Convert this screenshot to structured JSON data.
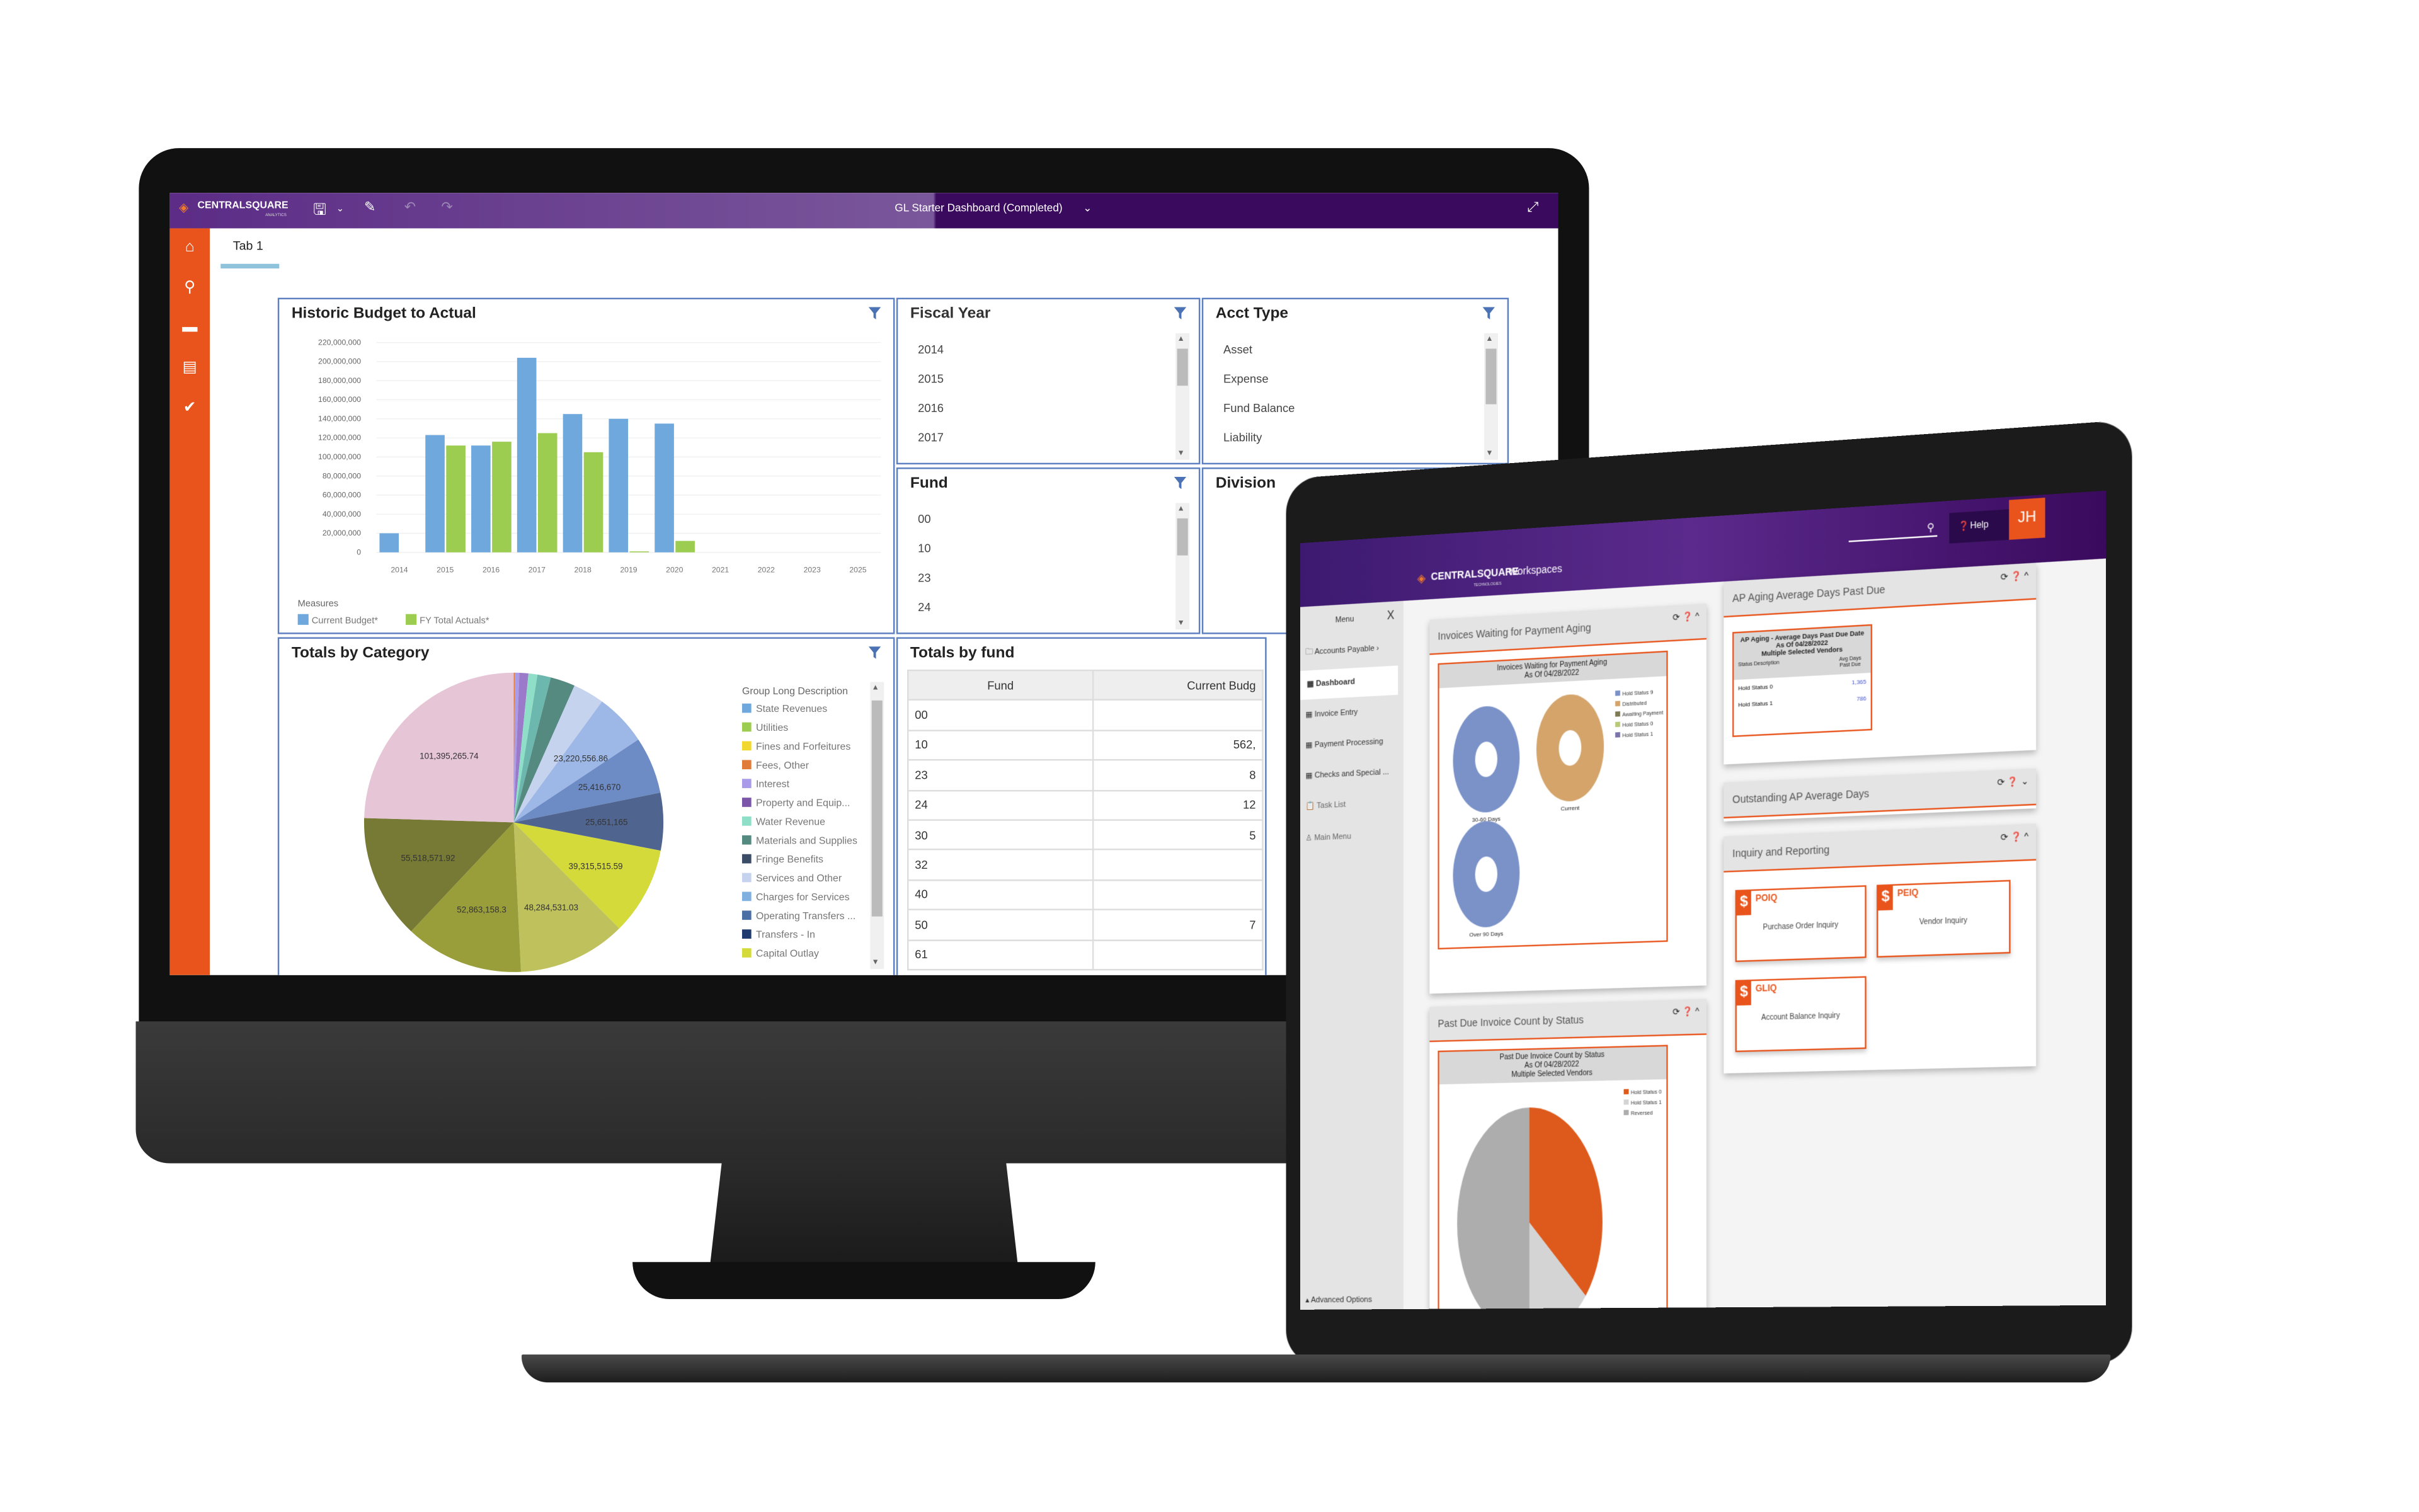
{
  "monitor": {
    "topbar": {
      "logo": "CENTRALSQUARE",
      "logo_sub": "ANALYTICS",
      "title": "GL Starter Dashboard (Completed)",
      "icons": [
        "save-icon",
        "chevron-down-icon",
        "pencil-icon",
        "undo-icon",
        "redo-icon",
        "expand-icon"
      ]
    },
    "sidebar_icons": [
      "home-icon",
      "search-icon",
      "folder-icon",
      "id-card-icon",
      "check-circle-icon"
    ],
    "tab": "Tab 1",
    "fiscal_year": {
      "title": "Fiscal Year",
      "items": [
        "2014",
        "2015",
        "2016",
        "2017"
      ]
    },
    "acct_type": {
      "title": "Acct Type",
      "items": [
        "Asset",
        "Expense",
        "Fund Balance",
        "Liability"
      ]
    },
    "fund": {
      "title": "Fund",
      "items": [
        "00",
        "10",
        "23",
        "24"
      ]
    },
    "division": {
      "title": "Division"
    },
    "totals_by_fund": {
      "title": "Totals by fund",
      "columns": [
        "Fund",
        "Current Budg"
      ],
      "rows": [
        [
          "00",
          ""
        ],
        [
          "10",
          "562,"
        ],
        [
          "23",
          "8"
        ],
        [
          "24",
          "12"
        ],
        [
          "30",
          "5"
        ],
        [
          "32",
          ""
        ],
        [
          "40",
          ""
        ],
        [
          "50",
          "7"
        ],
        [
          "61",
          ""
        ]
      ]
    },
    "pie_legend_title": "Group Long Description",
    "bar_legend_title": "Measures"
  },
  "chart_data": [
    {
      "type": "bar",
      "title": "Historic Budget to Actual",
      "categories": [
        "2014",
        "2015",
        "2016",
        "2017",
        "2018",
        "2019",
        "2020",
        "2021",
        "2022",
        "2023",
        "2025"
      ],
      "series": [
        {
          "name": "Current Budget*",
          "color": "#6fa8dc",
          "values": [
            20000000,
            123000000,
            112000000,
            204000000,
            145000000,
            140000000,
            135000000,
            0,
            0,
            0,
            0
          ]
        },
        {
          "name": "FY Total Actuals*",
          "color": "#9ccc50",
          "values": [
            0,
            112000000,
            116000000,
            125000000,
            105000000,
            1000000,
            12000000,
            0,
            0,
            0,
            0
          ]
        }
      ],
      "yticks": [
        "0",
        "20,000,000",
        "40,000,000",
        "60,000,000",
        "80,000,000",
        "100,000,000",
        "120,000,000",
        "140,000,000",
        "160,000,000",
        "180,000,000",
        "200,000,000",
        "220,000,000"
      ],
      "ylim": [
        0,
        220000000
      ],
      "grid": true,
      "legend": "bottom-left"
    },
    {
      "type": "pie",
      "title": "Totals by Category",
      "slices": [
        {
          "value": 500000,
          "color": "#e07b39",
          "label": ""
        },
        {
          "value": 2000000,
          "color": "#a99be8",
          "label": ""
        },
        {
          "value": 4000000,
          "color": "#9b7bc9",
          "label": ""
        },
        {
          "value": 4000000,
          "color": "#8fdfc8",
          "label": ""
        },
        {
          "value": 6000000,
          "color": "#6cb8ae",
          "label": ""
        },
        {
          "value": 11000000,
          "color": "#548a80",
          "label": ""
        },
        {
          "value": 14000000,
          "color": "#c6d3ef",
          "label": ""
        },
        {
          "value": 23220556.86,
          "color": "#9db8e6",
          "label": "23,220,556.86"
        },
        {
          "value": 25416670,
          "color": "#6d8bc4",
          "label": "25,416,670"
        },
        {
          "value": 25651165,
          "color": "#4f658f",
          "label": "25,651,165"
        },
        {
          "value": 39315515.59,
          "color": "#d4da3a",
          "label": "39,315,515.59"
        },
        {
          "value": 48284531.03,
          "color": "#bfc25c",
          "label": "48,284,531.03"
        },
        {
          "value": 52863158.3,
          "color": "#9a9e3a",
          "label": "52,863,158.3"
        },
        {
          "value": 55518571.92,
          "color": "#777a35",
          "label": "55,518,571.92"
        },
        {
          "value": 101395265.74,
          "color": "#e6c5d6",
          "label": "101,395,265.74"
        }
      ],
      "legend_title": "Group Long Description",
      "legend": [
        {
          "name": "State Revenues",
          "color": "#6fa8dc"
        },
        {
          "name": "Utilities",
          "color": "#9ccc50"
        },
        {
          "name": "Fines and Forfeitures",
          "color": "#f0d830"
        },
        {
          "name": "Fees, Other",
          "color": "#e07b39"
        },
        {
          "name": "Interest",
          "color": "#a99be8"
        },
        {
          "name": "Property and Equip...",
          "color": "#7a55a8"
        },
        {
          "name": "Water Revenue",
          "color": "#8fdfc8"
        },
        {
          "name": "Materials and Supplies",
          "color": "#548a80"
        },
        {
          "name": "Fringe Benefits",
          "color": "#3a4c66"
        },
        {
          "name": "Services and Other",
          "color": "#c6d3ef"
        },
        {
          "name": "Charges for Services",
          "color": "#7fb0e0"
        },
        {
          "name": "Operating Transfers ...",
          "color": "#4a6fa5"
        },
        {
          "name": "Transfers - In",
          "color": "#1f3a6e"
        },
        {
          "name": "Capital Outlay",
          "color": "#d4da3a"
        }
      ],
      "legend_placement": "right"
    },
    {
      "type": "pie",
      "title": "Past Due Invoice Count by Status",
      "subtitle": [
        "As Of 04/28/2022",
        "Multiple Selected Vendors"
      ],
      "slices": [
        {
          "name": "Hold Status 0",
          "value": 36,
          "color": "#dd5a1c"
        },
        {
          "name": "Hold Status 1",
          "value": 14,
          "color": "#d4d4d4"
        },
        {
          "name": "Reversed",
          "value": 50,
          "color": "#adadad"
        }
      ],
      "legend": "top-right"
    },
    {
      "type": "pie",
      "title": "Invoices Waiting for Payment Aging",
      "subtitle": [
        "As Of 04/28/2022"
      ],
      "donuts": [
        {
          "label": "30-60 Days",
          "color": "#7b92c9"
        },
        {
          "label": "Current",
          "color": "#d4a46b"
        },
        {
          "label": "Over 90 Days",
          "color": "#7b92c9"
        }
      ],
      "legend": [
        {
          "name": "Hold Status 9",
          "color": "#7b92c9"
        },
        {
          "name": "Distributed",
          "color": "#d4a46b"
        },
        {
          "name": "Awaiting Payment",
          "color": "#7f7a56"
        },
        {
          "name": "Hold Status 0",
          "color": "#b8c97a"
        },
        {
          "name": "Hold Status 1",
          "color": "#7a74a8"
        }
      ]
    }
  ],
  "laptop": {
    "logo": "CENTRALSQUARE",
    "logo_sub": "TECHNOLOGIES",
    "app": "Workspaces",
    "help": "Help",
    "user_initials": "JH",
    "menu": {
      "title": "Menu",
      "close": "X",
      "items": [
        "Accounts Payable",
        "Dashboard",
        "Invoice Entry",
        "Payment Processing",
        "Checks and Special ...",
        "Task List",
        "Main Menu"
      ],
      "advanced": "Advanced Options"
    },
    "widgets": {
      "invoices_waiting": "Invoices Waiting for Payment Aging",
      "past_due": "Past Due Invoice Count by Status",
      "ap_aging": "AP Aging Average Days Past Due",
      "outstanding": "Outstanding AP Average Days",
      "inquiry": "Inquiry and Reporting"
    },
    "ap_aging_table": {
      "title": "AP Aging - Average Days Past Due Date",
      "sub1": "As Of 04/28/2022",
      "sub2": "Multiple Selected Vendors",
      "col1": "Status Description",
      "col2": "Avg Days Past Due",
      "rows": [
        [
          "Hold Status 0",
          "1,365"
        ],
        [
          "Hold Status 1",
          "786"
        ]
      ]
    },
    "tiles": [
      {
        "code": "POIQ",
        "desc": "Purchase Order Inquiry"
      },
      {
        "code": "PEIQ",
        "desc": "Vendor Inquiry"
      },
      {
        "code": "GLIQ",
        "desc": "Account Balance Inquiry"
      }
    ],
    "accent": "#e8541b",
    "header_color": "#4a1f7a"
  }
}
